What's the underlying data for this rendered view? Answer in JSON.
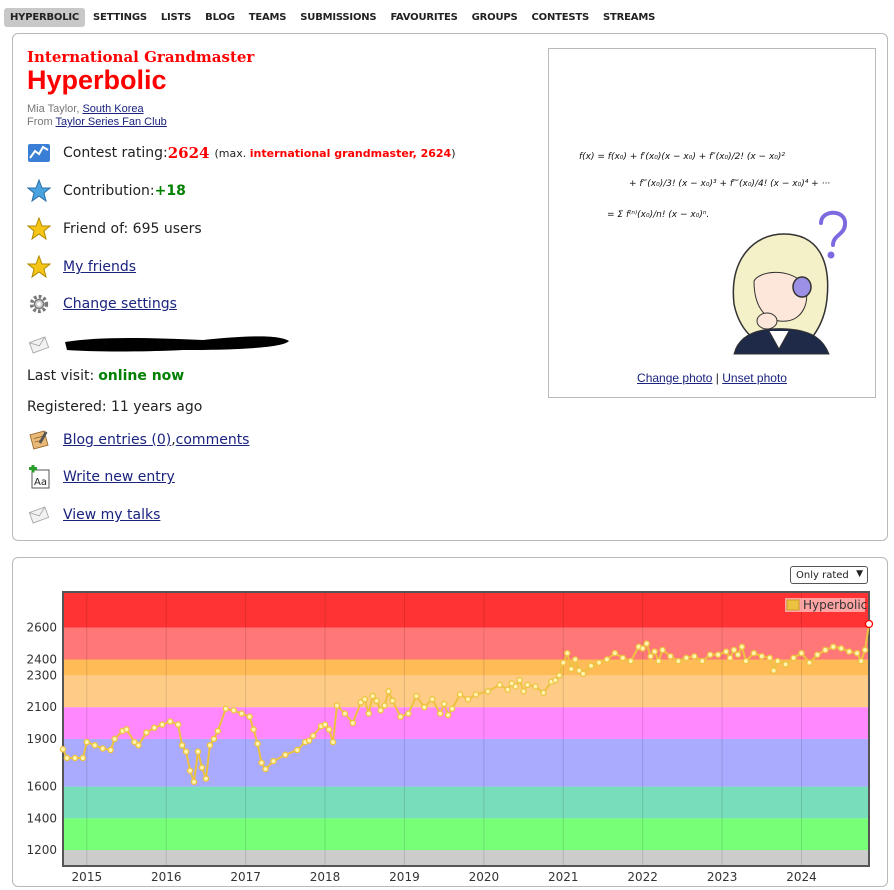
{
  "nav": {
    "items": [
      "HYPERBOLIC",
      "SETTINGS",
      "LISTS",
      "BLOG",
      "TEAMS",
      "SUBMISSIONS",
      "FAVOURITES",
      "GROUPS",
      "CONTESTS",
      "STREAMS"
    ],
    "active": "HYPERBOLIC"
  },
  "profile": {
    "rank": "International Grandmaster",
    "handle": "Hyperbolic",
    "name_prefix": "Mia Taylor, ",
    "country": "South Korea",
    "from_prefix": "From ",
    "organization": "Taylor Series Fan Club",
    "contest_rating_label": "Contest rating: ",
    "contest_rating": "2624",
    "max_prefix": "(max. ",
    "max_value": "international grandmaster, 2624",
    "max_suffix": ")",
    "contribution_label": "Contribution: ",
    "contribution": "+18",
    "friend_of": "Friend of: 695 users",
    "my_friends": "My friends",
    "change_settings": "Change settings",
    "last_visit_label": "Last visit: ",
    "last_visit": "online now",
    "registered": "Registered: 11 years ago",
    "blog_entries": "Blog entries (0)",
    "comma": ", ",
    "comments": "comments",
    "write_new_entry": "Write new entry",
    "view_talks": "View my talks"
  },
  "avatar": {
    "change_photo": "Change photo",
    "separator": " | ",
    "unset_photo": "Unset photo"
  },
  "graph": {
    "filter": "Only rated"
  },
  "colors": {
    "rank_red": "#ff0000",
    "link": "#1a237e",
    "online": "#008000",
    "line": "#edc240"
  },
  "chart_data": {
    "type": "line",
    "legend": "Hyperbolic",
    "legend_position": "top-right",
    "y_ticks": [
      1200,
      1400,
      1600,
      1900,
      2100,
      2300,
      2400,
      2600
    ],
    "x_ticks": [
      "2015",
      "2016",
      "2017",
      "2018",
      "2019",
      "2020",
      "2021",
      "2022",
      "2023",
      "2024"
    ],
    "xlim": [
      2014.7,
      2024.85
    ],
    "ylim": [
      1100,
      2825
    ],
    "bands": [
      {
        "from": 0,
        "to": 1200,
        "color": "#cccccc"
      },
      {
        "from": 1200,
        "to": 1400,
        "color": "#77ff77"
      },
      {
        "from": 1400,
        "to": 1600,
        "color": "#77ddbb"
      },
      {
        "from": 1600,
        "to": 1900,
        "color": "#aaaaff"
      },
      {
        "from": 1900,
        "to": 2100,
        "color": "#ff88ff"
      },
      {
        "from": 2100,
        "to": 2300,
        "color": "#ffcc88"
      },
      {
        "from": 2300,
        "to": 2400,
        "color": "#ffbb55"
      },
      {
        "from": 2400,
        "to": 2600,
        "color": "#ff7777"
      },
      {
        "from": 2600,
        "to": 5000,
        "color": "#ff3333"
      }
    ],
    "series": [
      {
        "name": "Hyperbolic",
        "x": [
          2014.7,
          2014.75,
          2014.85,
          2014.95,
          2015.0,
          2015.1,
          2015.2,
          2015.3,
          2015.35,
          2015.45,
          2015.5,
          2015.6,
          2015.65,
          2015.75,
          2015.85,
          2015.95,
          2016.05,
          2016.15,
          2016.2,
          2016.25,
          2016.3,
          2016.35,
          2016.4,
          2016.45,
          2016.5,
          2016.55,
          2016.6,
          2016.65,
          2016.75,
          2016.85,
          2016.95,
          2017.05,
          2017.1,
          2017.15,
          2017.2,
          2017.25,
          2017.35,
          2017.5,
          2017.65,
          2017.75,
          2017.8,
          2017.85,
          2017.95,
          2018.0,
          2018.05,
          2018.1,
          2018.15,
          2018.25,
          2018.35,
          2018.45,
          2018.5,
          2018.55,
          2018.6,
          2018.65,
          2018.7,
          2018.75,
          2018.8,
          2018.85,
          2018.95,
          2019.05,
          2019.15,
          2019.25,
          2019.35,
          2019.45,
          2019.5,
          2019.55,
          2019.6,
          2019.7,
          2019.8,
          2019.9,
          2020.05,
          2020.2,
          2020.3,
          2020.35,
          2020.4,
          2020.45,
          2020.5,
          2020.55,
          2020.65,
          2020.75,
          2020.85,
          2020.9,
          2020.95,
          2021.0,
          2021.05,
          2021.1,
          2021.15,
          2021.2,
          2021.25,
          2021.35,
          2021.45,
          2021.55,
          2021.65,
          2021.75,
          2021.85,
          2021.95,
          2022.0,
          2022.05,
          2022.1,
          2022.15,
          2022.2,
          2022.25,
          2022.35,
          2022.45,
          2022.55,
          2022.65,
          2022.75,
          2022.85,
          2022.95,
          2023.05,
          2023.1,
          2023.15,
          2023.2,
          2023.25,
          2023.3,
          2023.4,
          2023.5,
          2023.6,
          2023.65,
          2023.7,
          2023.8,
          2023.9,
          2024.0,
          2024.1,
          2024.2,
          2024.3,
          2024.4,
          2024.5,
          2024.6,
          2024.7,
          2024.75,
          2024.8,
          2024.85
        ],
        "y": [
          1835,
          1780,
          1780,
          1780,
          1880,
          1860,
          1840,
          1830,
          1900,
          1950,
          1960,
          1880,
          1860,
          1940,
          1970,
          1990,
          2010,
          1990,
          1860,
          1820,
          1700,
          1630,
          1820,
          1720,
          1650,
          1860,
          1900,
          1950,
          2090,
          2080,
          2060,
          2040,
          1960,
          1870,
          1750,
          1710,
          1760,
          1800,
          1830,
          1880,
          1890,
          1920,
          1980,
          1990,
          1960,
          1880,
          2110,
          2060,
          2000,
          2130,
          2150,
          2060,
          2170,
          2140,
          2080,
          2110,
          2200,
          2140,
          2040,
          2060,
          2170,
          2100,
          2150,
          2060,
          2120,
          2050,
          2090,
          2180,
          2150,
          2180,
          2200,
          2240,
          2210,
          2250,
          2230,
          2270,
          2200,
          2240,
          2230,
          2190,
          2260,
          2270,
          2300,
          2380,
          2440,
          2340,
          2400,
          2330,
          2310,
          2360,
          2380,
          2400,
          2440,
          2410,
          2390,
          2480,
          2470,
          2500,
          2420,
          2450,
          2390,
          2460,
          2420,
          2390,
          2410,
          2420,
          2390,
          2430,
          2430,
          2450,
          2410,
          2460,
          2430,
          2480,
          2390,
          2440,
          2420,
          2410,
          2330,
          2390,
          2370,
          2410,
          2440,
          2380,
          2430,
          2460,
          2480,
          2470,
          2450,
          2440,
          2390,
          2460,
          2624
        ]
      }
    ]
  }
}
